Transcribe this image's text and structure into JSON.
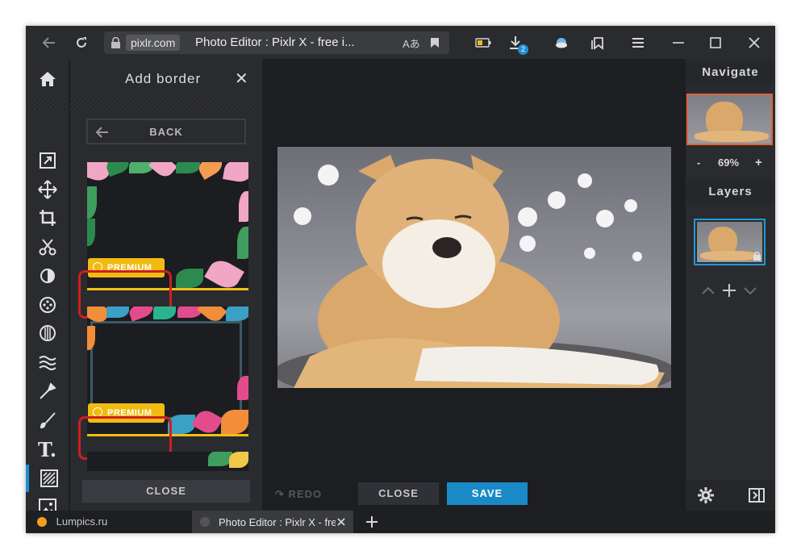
{
  "browser": {
    "domain": "pixlr.com",
    "page_title": "Photo Editor : Pixlr X - free i...",
    "download_badge": "2"
  },
  "panel": {
    "title": "Add border",
    "back_label": "BACK",
    "premium_label": "PREMIUM",
    "close_label": "CLOSE"
  },
  "canvas": {
    "redo_label": "REDO",
    "close_label": "CLOSE",
    "save_label": "SAVE"
  },
  "right": {
    "navigate_label": "Navigate",
    "zoom_minus": "-",
    "zoom_value": "69%",
    "zoom_plus": "+",
    "layers_label": "Layers"
  },
  "tabs": [
    {
      "label": "Lumpics.ru"
    },
    {
      "label": "Photo Editor : Pixlr X - fre"
    }
  ],
  "colors": {
    "accent": "#1a8ac7",
    "premium": "#f0bc12",
    "highlight": "#cf1e24"
  }
}
